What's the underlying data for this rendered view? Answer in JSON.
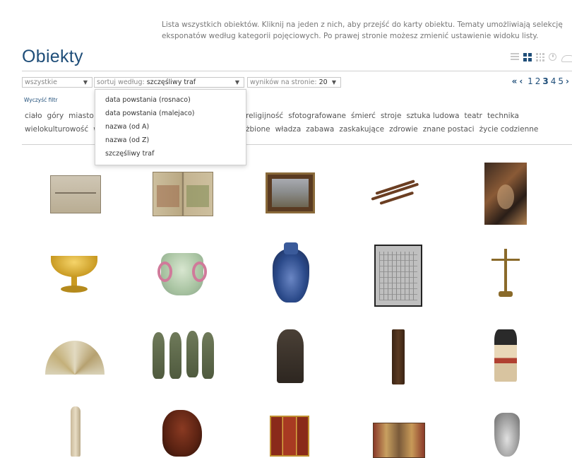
{
  "intro": "Lista wszystkich obiektów. Kliknij na jeden z nich, aby przejść do karty obiektu. Tematy umożliwiają selekcję eksponatów według kategorii pojęciowych. Po prawej stronie możesz zmienić ustawienie widoku listy.",
  "title": "Obiekty",
  "view_icons": [
    "list-view-icon",
    "grid-view-icon",
    "small-grid-view-icon",
    "timeline-view-icon",
    "cloud-view-icon"
  ],
  "filters": {
    "category_value": "wszystkie",
    "sort_label": "sortuj według:",
    "sort_value": "szczęśliwy traf",
    "per_page_label": "wyników na stronie:",
    "per_page_value": "20"
  },
  "sort_options": [
    "data powstania (rosnaco)",
    "data powstania (malejaco)",
    "nazwa (od A)",
    "nazwa (od Z)",
    "szczęśliwy traf"
  ],
  "pagination": {
    "first": "«",
    "prev": "‹",
    "pages": [
      "1",
      "2",
      "3",
      "4",
      "5"
    ],
    "current": "3",
    "next": "›"
  },
  "clear_filter": "Wyczyść filtr",
  "tags_row1_left": [
    "ciało",
    "góry",
    "miasto"
  ],
  "tags_row1_right": [
    "religijność",
    "sfotografowane",
    "śmierć",
    "stroje",
    "sztuka ludowa",
    "teatr",
    "technika"
  ],
  "tags_row2_left": [
    "wielokulturowość",
    "w"
  ],
  "tags_row2_right": [
    "żbione",
    "władza",
    "zabawa",
    "zaskakujące",
    "zdrowie",
    "znane postaci",
    "życie codzienne"
  ],
  "accent_color": "#1f4e79"
}
